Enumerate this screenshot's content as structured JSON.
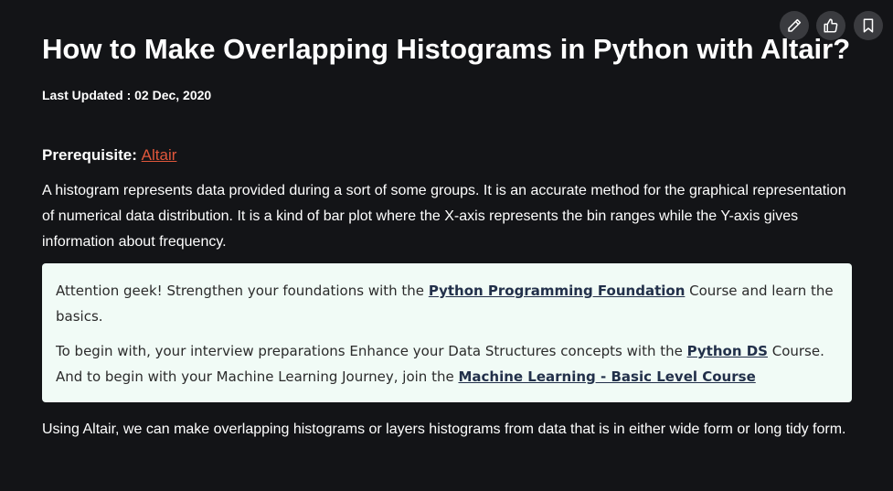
{
  "toolbar": {
    "edit_icon": "pencil-icon",
    "like_icon": "thumbs-up-icon",
    "bookmark_icon": "bookmark-icon"
  },
  "article": {
    "title": "How to Make Overlapping Histograms in Python with Altair?",
    "last_updated": "Last Updated : 02 Dec, 2020",
    "prerequisite_label": "Prerequisite:",
    "prerequisite_link": "Altair",
    "intro": "A histogram represents data provided during a sort of some groups. It is an accurate method for the graphical representation of numerical data distribution. It is a kind of bar plot where the X-axis represents the bin ranges while the Y-axis gives information about frequency.",
    "body": "Using Altair, we can make overlapping histograms or layers histograms from data that is in either wide form or long tidy form."
  },
  "callout": {
    "line1_before": " Attention geek! Strengthen your foundations with the ",
    "line1_link": "Python Programming Foundation",
    "line1_after": " Course and learn the basics.",
    "line2_before": "To begin with, your interview preparations Enhance your Data Structures concepts with the ",
    "line2_link1": "Python DS",
    "line2_middle": " Course. And to begin with your Machine Learning Journey, join the ",
    "line2_link2": "Machine Learning - Basic Level Course"
  },
  "colors": {
    "background": "#131417",
    "link_accent": "#e0573b",
    "callout_bg": "#f1fbf6"
  }
}
